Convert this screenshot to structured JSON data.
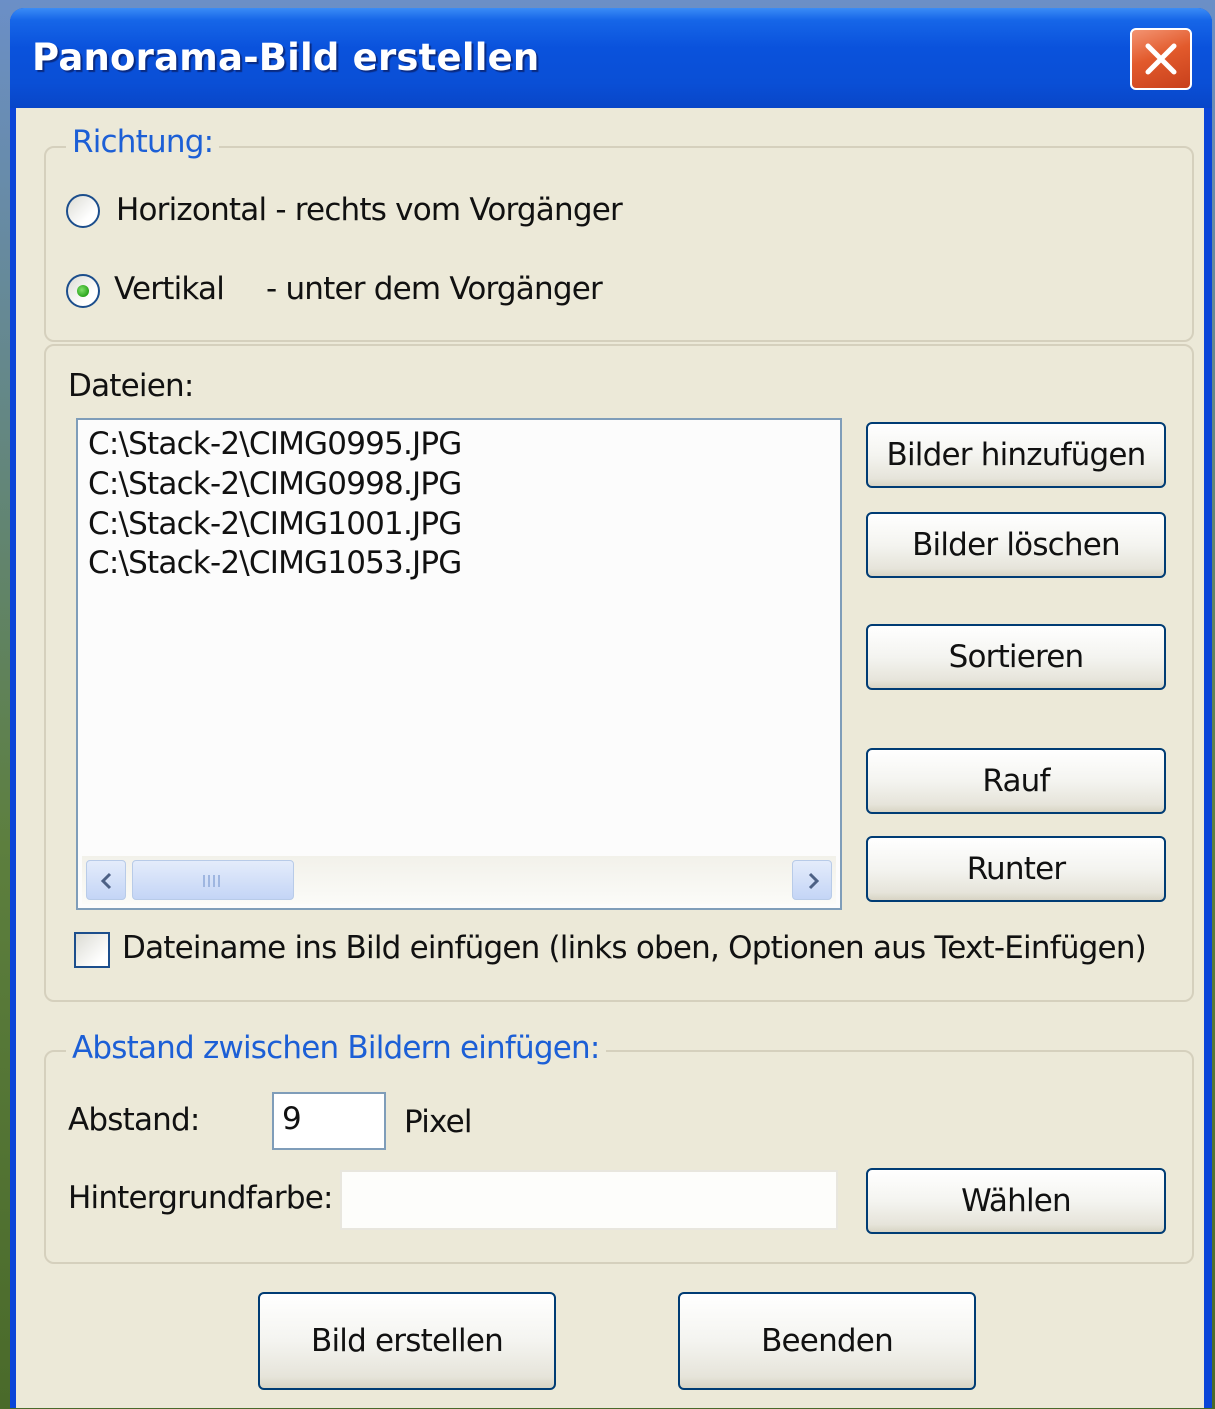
{
  "window": {
    "title": "Panorama-Bild erstellen"
  },
  "direction": {
    "group_label": "Richtung:",
    "horizontal_label": "Horizontal - rechts vom Vorgänger",
    "vertical_label": "Vertikal",
    "vertical_suffix": "- unter dem Vorgänger",
    "selected": "vertical"
  },
  "files": {
    "label": "Dateien:",
    "items": [
      "C:\\Stack-2\\CIMG0995.JPG",
      "C:\\Stack-2\\CIMG0998.JPG",
      "C:\\Stack-2\\CIMG1001.JPG",
      "C:\\Stack-2\\CIMG1053.JPG"
    ],
    "buttons": {
      "add": "Bilder hinzufügen",
      "delete": "Bilder löschen",
      "sort": "Sortieren",
      "up": "Rauf",
      "down": "Runter"
    },
    "filename_checkbox_label": "Dateiname ins Bild einfügen (links oben, Optionen aus Text-Einfügen)",
    "filename_checkbox_checked": false
  },
  "spacing": {
    "group_label": "Abstand zwischen Bildern einfügen:",
    "distance_label": "Abstand:",
    "distance_value": "9",
    "distance_unit": "Pixel",
    "bgcolor_label": "Hintergrundfarbe:",
    "bgcolor_value": "",
    "choose_button": "Wählen"
  },
  "footer": {
    "create_button": "Bild erstellen",
    "close_button": "Beenden"
  },
  "colors": {
    "titlebar": "#0a52dc",
    "client_bg": "#ece9d8",
    "group_label": "#1c5fd6",
    "close_button": "#e25a2c"
  }
}
